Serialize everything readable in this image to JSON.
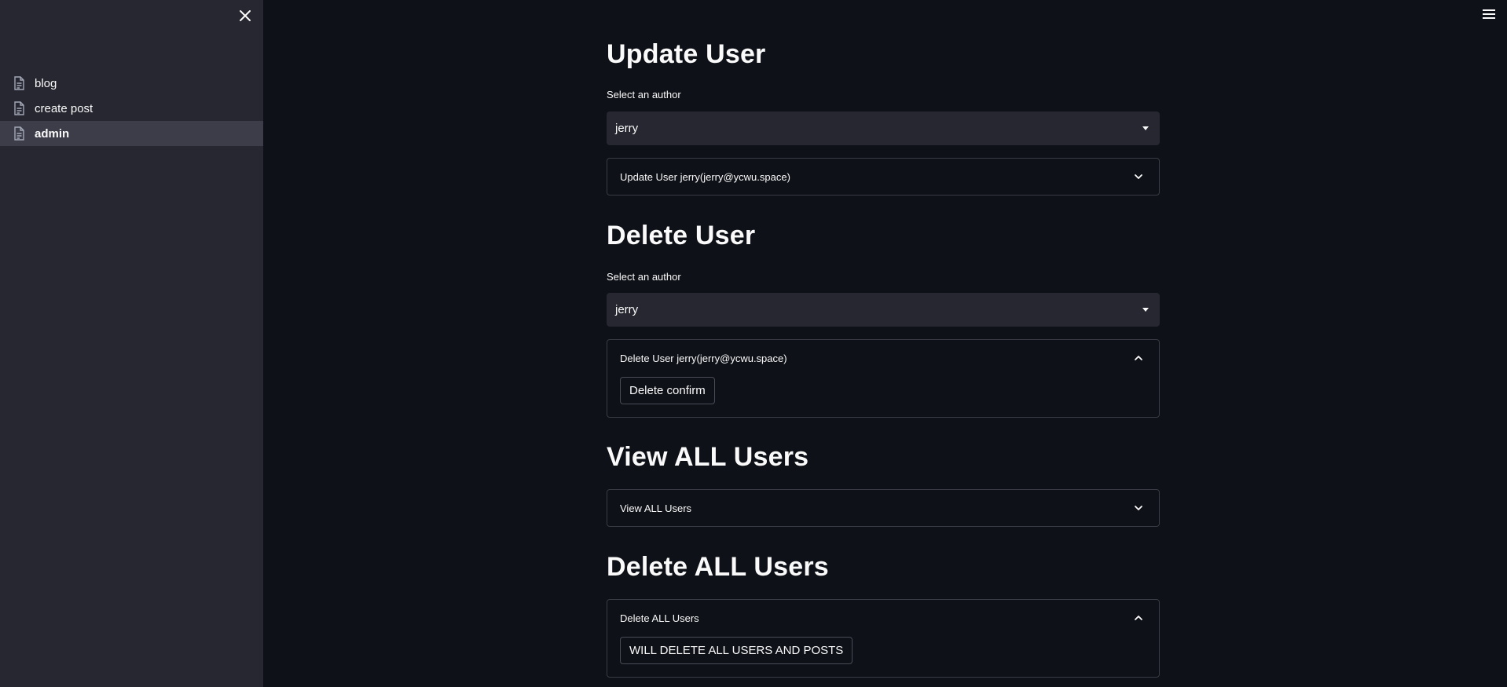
{
  "sidebar": {
    "items": [
      {
        "label": "blog",
        "icon": "document-icon"
      },
      {
        "label": "create post",
        "icon": "document-icon"
      },
      {
        "label": "admin",
        "icon": "document-icon"
      }
    ]
  },
  "sections": {
    "update": {
      "heading": "Update User",
      "select_label": "Select an author",
      "selected": "jerry",
      "expander_title": "Update User jerry(jerry@ycwu.space)"
    },
    "delete": {
      "heading": "Delete User",
      "select_label": "Select an author",
      "selected": "jerry",
      "expander_title": "Delete User jerry(jerry@ycwu.space)",
      "button": "Delete confirm"
    },
    "view_all": {
      "heading": "View ALL Users",
      "expander_title": "View ALL Users"
    },
    "delete_all": {
      "heading": "Delete ALL Users",
      "expander_title": "Delete ALL Users",
      "button": "WILL DELETE ALL USERS AND POSTS"
    }
  },
  "colors": {
    "background": "#0e1117",
    "sidebar": "#262730",
    "text": "#fafafa"
  }
}
